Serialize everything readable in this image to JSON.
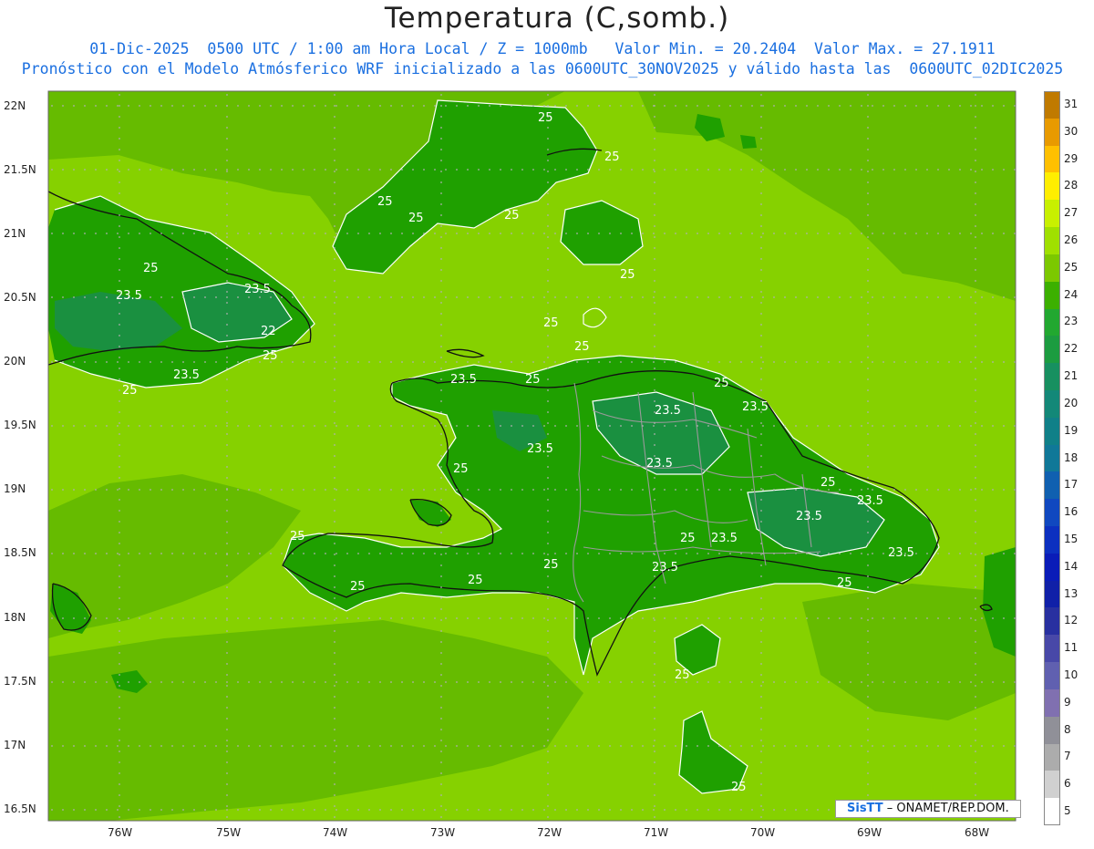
{
  "header": {
    "title": "Temperatura (C,somb.)",
    "line1": "01-Dic-2025  0500 UTC / 1:00 am Hora Local / Z = 1000mb   Valor Min. = 20.2404  Valor Max. = 27.1911",
    "line2": "Pronóstico con el Modelo Atmósferico WRF inicializado a las 0600UTC_30NOV2025 y válido hasta las  0600UTC_02DIC2025"
  },
  "axes": {
    "lat_labels": [
      "22N",
      "21.5N",
      "21N",
      "20.5N",
      "20N",
      "19.5N",
      "19N",
      "18.5N",
      "18N",
      "17.5N",
      "17N",
      "16.5N"
    ],
    "lon_labels": [
      "76W",
      "75W",
      "74W",
      "73W",
      "72W",
      "71W",
      "70W",
      "69W",
      "68W"
    ]
  },
  "contour_labels": [
    "25",
    "23.5",
    "22"
  ],
  "colorbar": {
    "labels": [
      "31",
      "30",
      "29",
      "28",
      "27",
      "26",
      "25",
      "24",
      "23",
      "22",
      "21",
      "20",
      "19",
      "18",
      "17",
      "16",
      "15",
      "14",
      "13",
      "12",
      "11",
      "10",
      "9",
      "8",
      "7",
      "6",
      "5"
    ],
    "colors": [
      "#c07a00",
      "#e89a00",
      "#ffc000",
      "#ffee00",
      "#c8f000",
      "#a0e000",
      "#7cc800",
      "#3cb000",
      "#22a830",
      "#1c9c40",
      "#179060",
      "#138878",
      "#108088",
      "#107898",
      "#1060b0",
      "#1048c0",
      "#0c30c0",
      "#0a1cb8",
      "#1020a8",
      "#2830a0",
      "#4848a8",
      "#6060b0",
      "#8070b0",
      "#909098",
      "#acacac",
      "#d0d0d0",
      "#ffffff"
    ]
  },
  "credit": {
    "logo": "SisTT",
    "text": " – ONAMET/REP.DOM."
  }
}
